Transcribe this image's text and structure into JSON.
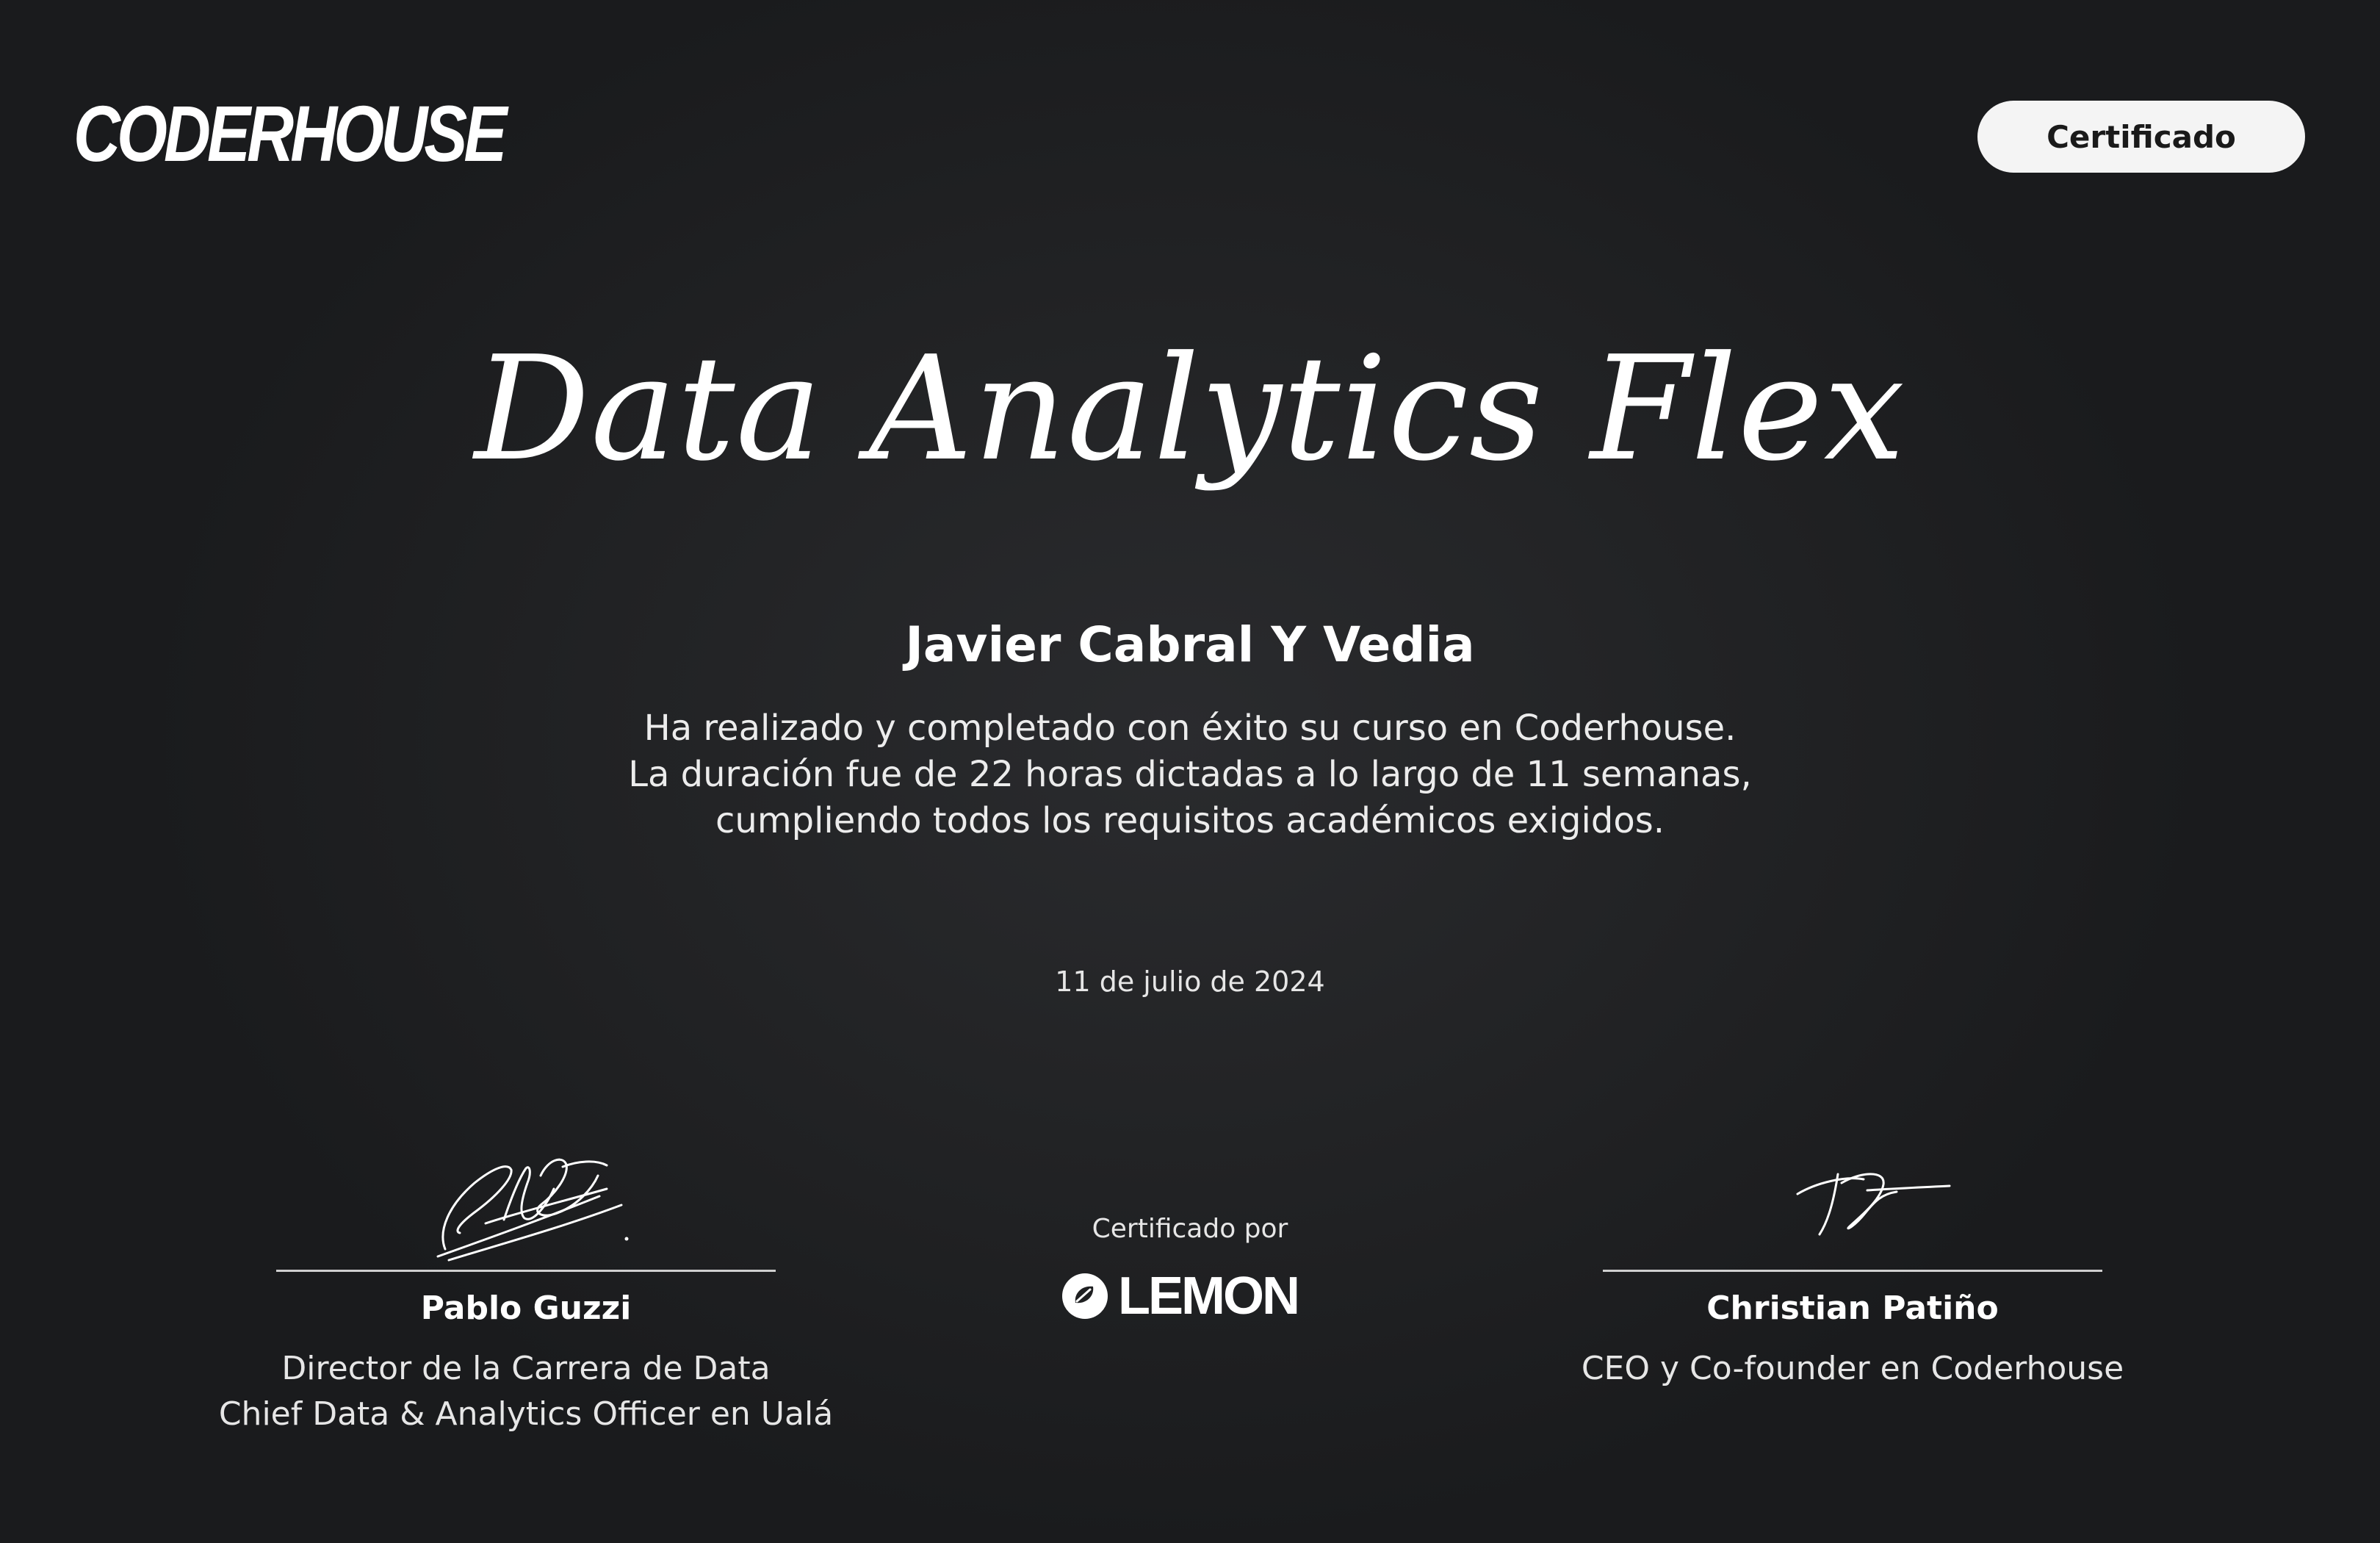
{
  "brand": {
    "logo_text": "CODERHOUSE"
  },
  "badge": {
    "label": "Certificado"
  },
  "course": {
    "title": "Data Analytics Flex"
  },
  "student": {
    "name": "Javier Cabral Y Vedia"
  },
  "description": {
    "lines": [
      "Ha realizado y completado con éxito su curso en Coderhouse.",
      "La duración fue de 22 horas dictadas a lo largo de 11 semanas,",
      "cumpliendo todos los requisitos académicos exigidos."
    ]
  },
  "date": "11 de julio de 2024",
  "signers": [
    {
      "name": "Pablo Guzzi",
      "roles": [
        "Director de la Carrera de Data",
        "Chief Data & Analytics Officer en Ualá"
      ]
    },
    {
      "name": "Christian Patiño",
      "roles": [
        "CEO y Co-founder en Coderhouse"
      ]
    }
  ],
  "certifier": {
    "label": "Certificado por",
    "logo_text": "LEMON"
  },
  "colors": {
    "background": "#1f2022",
    "text": "#ffffff",
    "badge_bg": "#f4f4f4",
    "badge_text": "#1a1a1a",
    "rule": "#cfcfcf"
  }
}
